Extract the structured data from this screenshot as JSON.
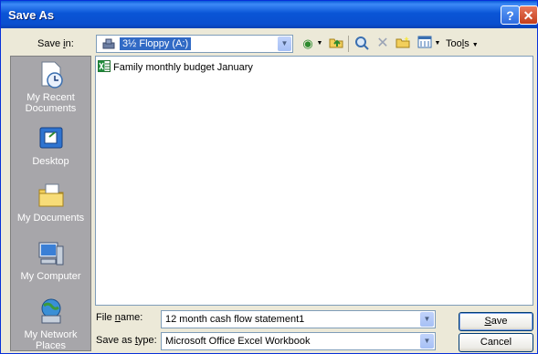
{
  "window": {
    "title": "Save As",
    "help_icon": "help-icon",
    "close_icon": "close-icon"
  },
  "toolbar": {
    "save_in_label_pre": "Save ",
    "save_in_label_accel": "i",
    "save_in_label_post": "n:",
    "save_in_value": "3½ Floppy (A:)",
    "tools_label_pre": "Too",
    "tools_label_accel": "l",
    "tools_label_post": "s"
  },
  "places": [
    {
      "label_line1": "My Recent",
      "label_line2": "Documents",
      "icon": "recent-documents-icon"
    },
    {
      "label_line1": "Desktop",
      "label_line2": "",
      "icon": "desktop-icon"
    },
    {
      "label_line1": "My Documents",
      "label_line2": "",
      "icon": "my-documents-icon"
    },
    {
      "label_line1": "My Computer",
      "label_line2": "",
      "icon": "my-computer-icon"
    },
    {
      "label_line1": "My Network",
      "label_line2": "Places",
      "icon": "network-places-icon"
    }
  ],
  "files": [
    {
      "name": "Family monthly budget January",
      "icon": "excel-file-icon"
    }
  ],
  "form": {
    "file_name_label_pre": "File ",
    "file_name_label_accel": "n",
    "file_name_label_post": "ame:",
    "file_name_value": "12 month cash flow statement1",
    "type_label_pre": "Save as ",
    "type_label_accel": "t",
    "type_label_post": "ype:",
    "type_value": "Microsoft Office Excel Workbook",
    "save_button_accel": "S",
    "save_button_rest": "ave",
    "cancel_button": "Cancel"
  },
  "colors": {
    "title_bar": "#0a55d6",
    "selection": "#316ac5",
    "places_bar": "#a7a6aa",
    "dialog_bg": "#ece9d8"
  }
}
